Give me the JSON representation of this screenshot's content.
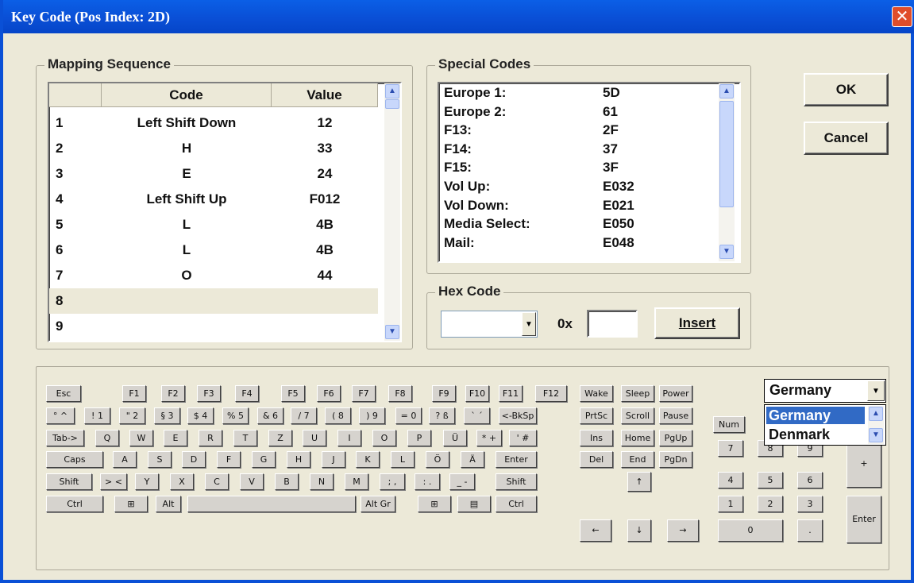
{
  "window": {
    "title": "Key Code (Pos Index: 2D)",
    "close_glyph": "✕"
  },
  "mapping": {
    "group_title": "Mapping Sequence",
    "columns": [
      "",
      "Code",
      "Value"
    ],
    "rows": [
      {
        "index": "1",
        "code": "Left Shift Down",
        "value": "12"
      },
      {
        "index": "2",
        "code": "H",
        "value": "33"
      },
      {
        "index": "3",
        "code": "E",
        "value": "24"
      },
      {
        "index": "4",
        "code": "Left Shift Up",
        "value": "F012"
      },
      {
        "index": "5",
        "code": "L",
        "value": "4B"
      },
      {
        "index": "6",
        "code": "L",
        "value": "4B"
      },
      {
        "index": "7",
        "code": "O",
        "value": "44"
      },
      {
        "index": "8",
        "code": "",
        "value": ""
      },
      {
        "index": "9",
        "code": "",
        "value": ""
      }
    ]
  },
  "special": {
    "group_title": "Special Codes",
    "rows": [
      {
        "name": "Europe 1:",
        "code": "5D"
      },
      {
        "name": "Europe 2:",
        "code": "61"
      },
      {
        "name": "F13:",
        "code": "2F"
      },
      {
        "name": "F14:",
        "code": "37"
      },
      {
        "name": "F15:",
        "code": "3F"
      },
      {
        "name": "Vol Up:",
        "code": "E032"
      },
      {
        "name": "Vol Down:",
        "code": "E021"
      },
      {
        "name": "Media Select:",
        "code": "E050"
      },
      {
        "name": "Mail:",
        "code": "E048"
      }
    ]
  },
  "hex": {
    "group_title": "Hex Code",
    "prefix": "0x",
    "combo_value": "",
    "input_value": "",
    "insert_label": "Insert"
  },
  "buttons": {
    "ok": "OK",
    "cancel": "Cancel"
  },
  "layout_select": {
    "value": "Germany",
    "options": [
      "Germany",
      "Denmark"
    ],
    "selected_option": "Germany"
  },
  "keyboard": {
    "row1": [
      "Esc",
      "F1",
      "F2",
      "F3",
      "F4",
      "F5",
      "F6",
      "F7",
      "F8",
      "F9",
      "F10",
      "F11",
      "F12"
    ],
    "row2": [
      "° ^",
      "! 1",
      "\" 2",
      "§ 3",
      "$ 4",
      "% 5",
      "& 6",
      "/ 7",
      "( 8",
      ") 9",
      "= 0",
      "? ß",
      "` ´",
      "<-BkSp"
    ],
    "row3": [
      "Tab->",
      "Q",
      "W",
      "E",
      "R",
      "T",
      "Z",
      "U",
      "I",
      "O",
      "P",
      "Ü",
      "* +",
      "' #"
    ],
    "row4": [
      "Caps",
      "A",
      "S",
      "D",
      "F",
      "G",
      "H",
      "J",
      "K",
      "L",
      "Ö",
      "Ä",
      "Enter"
    ],
    "row5": [
      "Shift",
      "> <",
      "Y",
      "X",
      "C",
      "V",
      "B",
      "N",
      "M",
      "; ,",
      ": .",
      "_ -",
      "Shift"
    ],
    "row6": [
      "Ctrl",
      "⊞",
      "Alt",
      "",
      "Alt Gr",
      "⊞",
      "▤",
      "Ctrl"
    ],
    "sys": [
      "Wake",
      "Sleep",
      "Power"
    ],
    "nav1": [
      "PrtSc",
      "Scroll",
      "Pause"
    ],
    "nav2": [
      "Ins",
      "Home",
      "PgUp"
    ],
    "nav3": [
      "Del",
      "End",
      "PgDn"
    ],
    "arrows": [
      "↑",
      "←",
      "↓",
      "→"
    ],
    "numpad": {
      "num": "Num",
      "r1": [
        "7",
        "8",
        "9"
      ],
      "r2": [
        "4",
        "5",
        "6"
      ],
      "r3": [
        "1",
        "2",
        "3"
      ],
      "zero": "0",
      "dot": ".",
      "plus": "+",
      "enter": "Enter"
    }
  }
}
